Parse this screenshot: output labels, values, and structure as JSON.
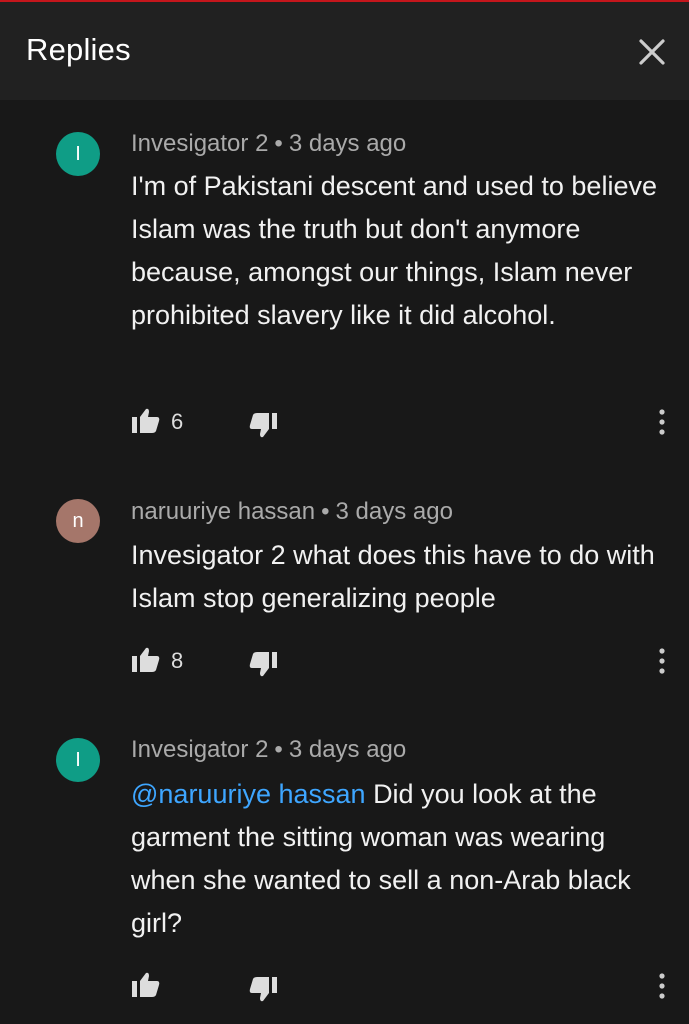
{
  "header": {
    "title": "Replies"
  },
  "colors": {
    "background": "#181818",
    "header_background": "#212121",
    "mention": "#3ea6ff",
    "avatar_teal": "#0f9d86",
    "avatar_brown": "#a5766a"
  },
  "icons": {
    "close": "close-icon",
    "like": "thumbs-up-icon",
    "dislike": "thumbs-down-icon",
    "more": "more-vertical-icon"
  },
  "comments": [
    {
      "avatar_letter": "I",
      "author": "Invesigator 2",
      "separator": "•",
      "time": "3 days ago",
      "mention": "",
      "text": "I'm of Pakistani descent and used to believe Islam was the truth but don't anymore because, amongst our things, Islam never prohibited slavery like it did alcohol.",
      "likes": "6"
    },
    {
      "avatar_letter": "n",
      "author": "naruuriye hassan",
      "separator": "•",
      "time": "3 days ago",
      "mention": "",
      "text": "Invesigator 2 what does this have to do with Islam stop generalizing people",
      "likes": "8"
    },
    {
      "avatar_letter": "I",
      "author": "Invesigator 2",
      "separator": "•",
      "time": "3 days ago",
      "mention": "@naruuriye hassan",
      "text": "Did you look at the garment the sitting woman was wearing when she wanted to sell a non-Arab black girl?",
      "likes": ""
    }
  ]
}
